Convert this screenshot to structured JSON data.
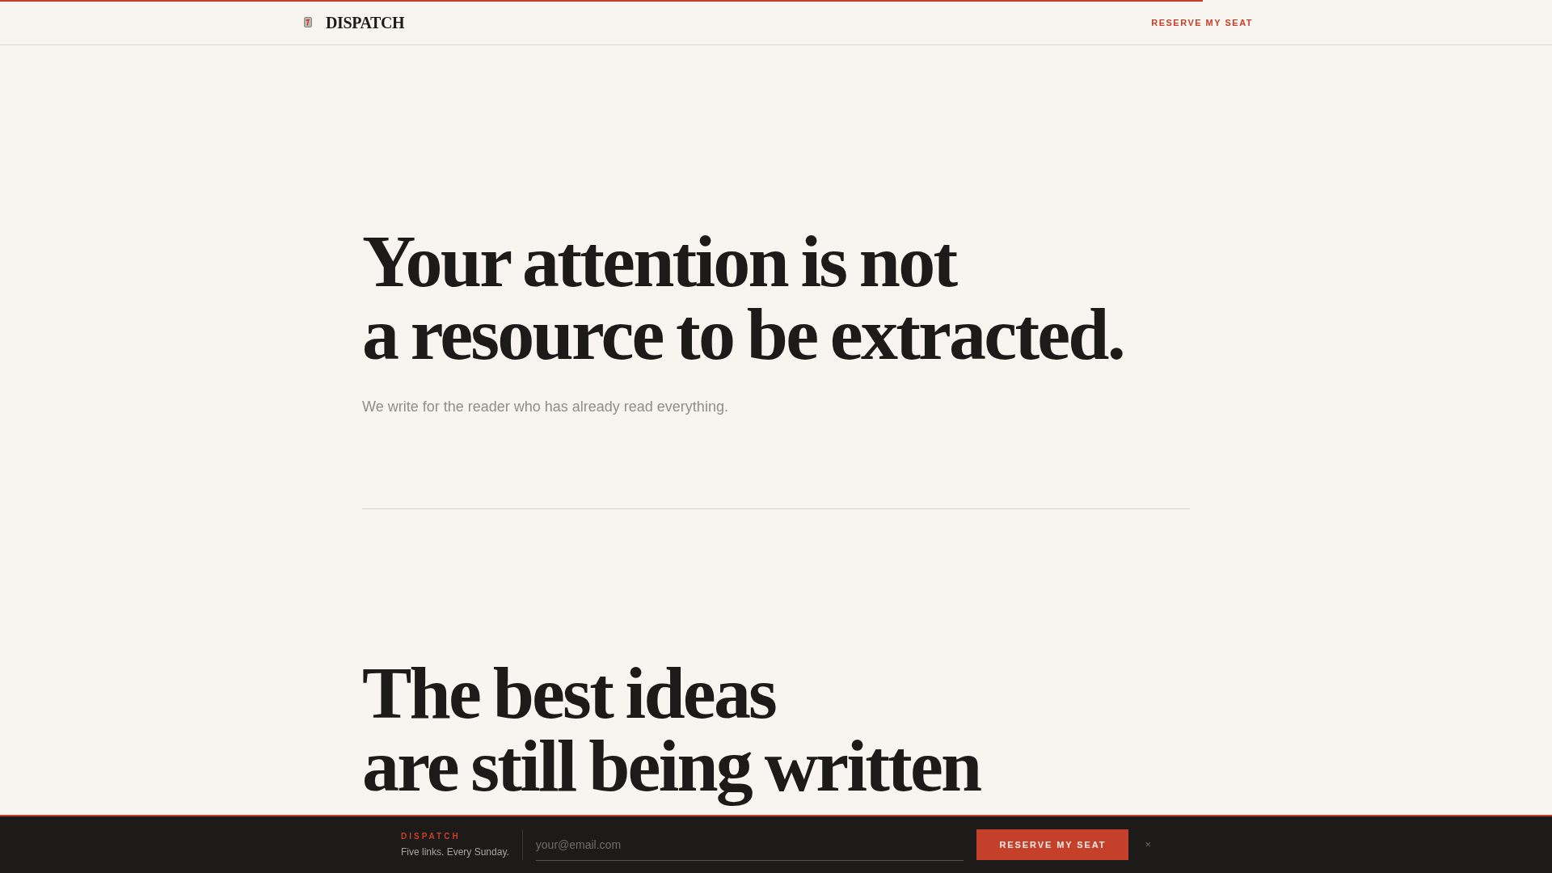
{
  "progress": {
    "level": 0.775
  },
  "header": {
    "brand": "DISPATCH",
    "cta": "RESERVE MY SEAT"
  },
  "sections": [
    {
      "headline": [
        "Your attention is not",
        "a resource to be extracted."
      ],
      "subtitle": "We write for the reader who has already read everything."
    },
    {
      "headline": [
        "The best ideas",
        "are still being written"
      ]
    }
  ],
  "signup_bar": {
    "brand": "DISPATCH",
    "tagline": "Five links. Every Sunday.",
    "email": {
      "placeholder": "your@email.com"
    },
    "button": "RESERVE MY SEAT",
    "close": "×"
  }
}
